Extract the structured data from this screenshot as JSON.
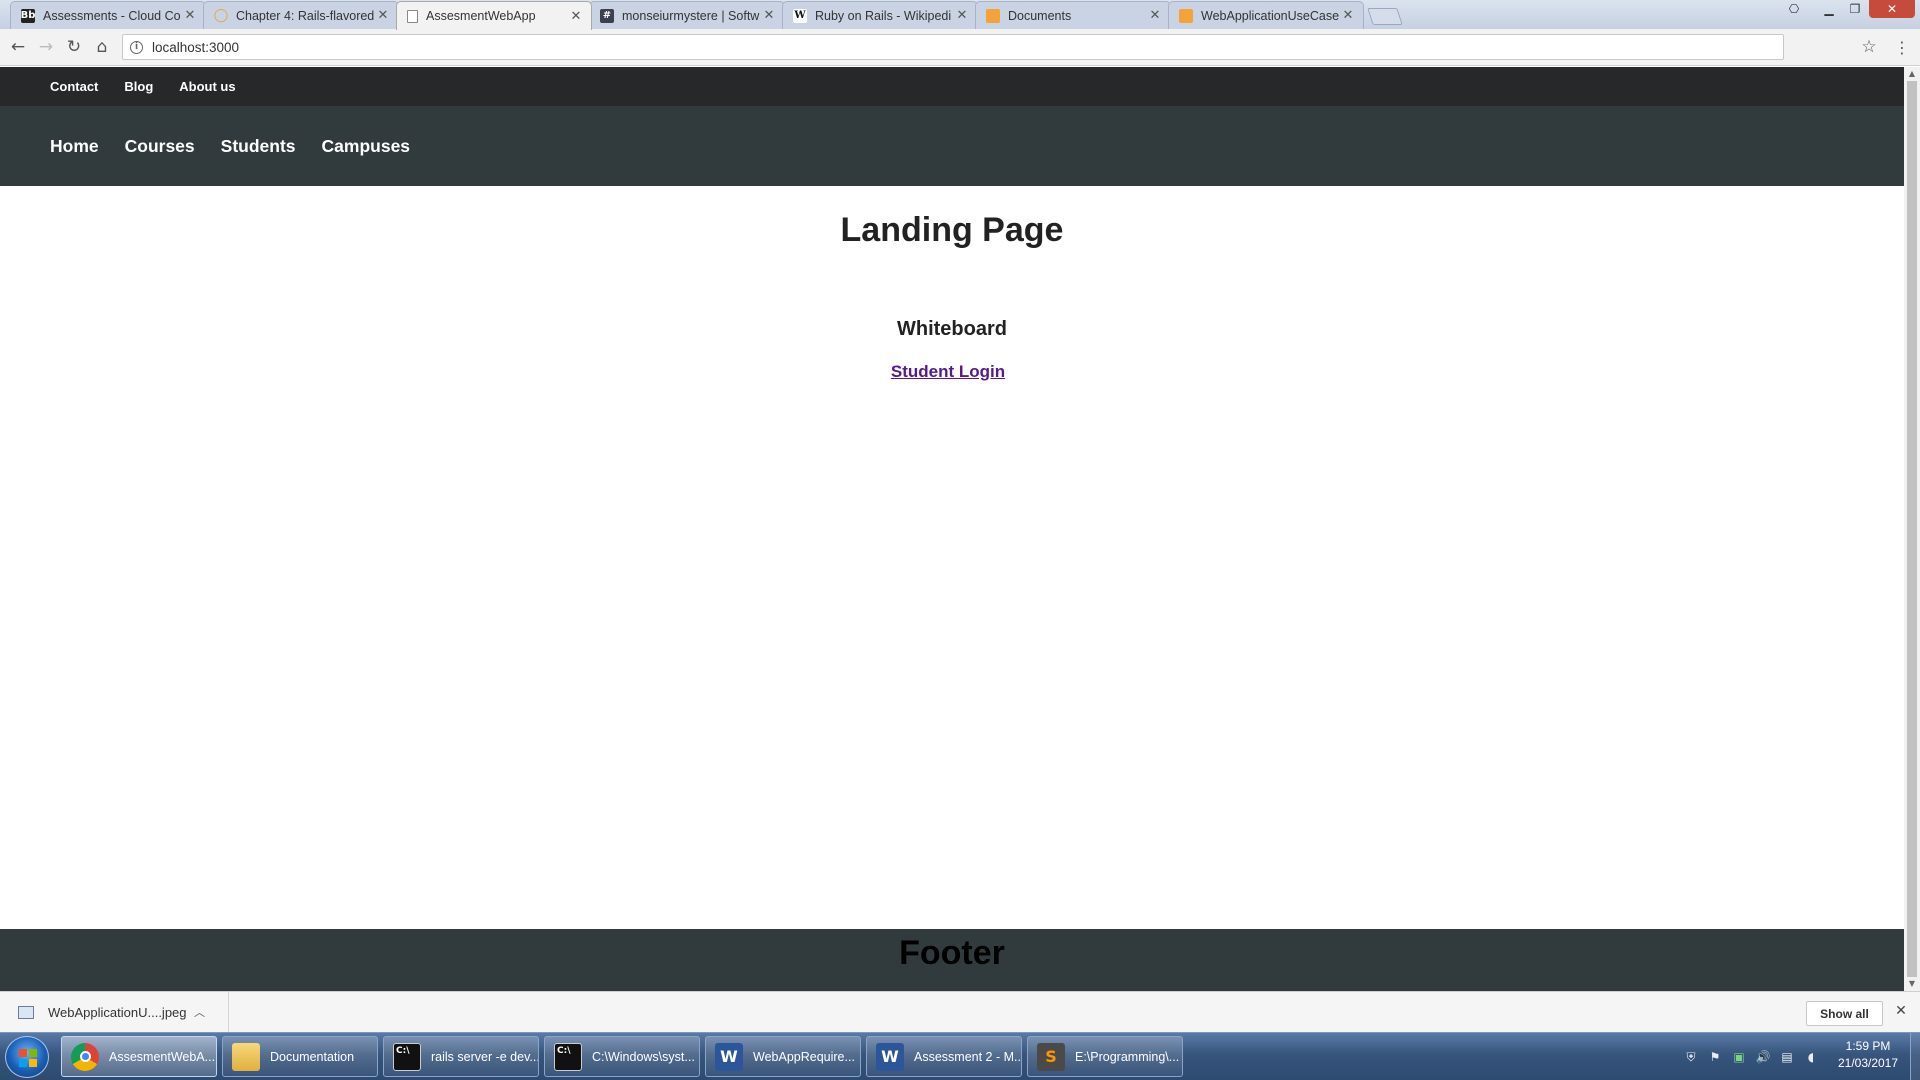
{
  "browser": {
    "tabs": [
      {
        "title": "Assessments - Cloud Co",
        "icon": "bb-icon",
        "icon_text": "Bb",
        "icon_color": "#222222",
        "active": false
      },
      {
        "title": "Chapter 4: Rails-flavored",
        "icon": "tutorial-icon",
        "icon_text": "◯",
        "icon_color": "#e8a23a",
        "active": false
      },
      {
        "title": "AssesmentWebApp",
        "icon": "page-icon",
        "icon_text": "",
        "icon_color": "#ffffff",
        "active": true
      },
      {
        "title": "monseiurmystere | Softw",
        "icon": "hash-icon",
        "icon_text": "#",
        "icon_color": "#3b3f4f",
        "active": false
      },
      {
        "title": "Ruby on Rails - Wikipedi",
        "icon": "wikipedia-icon",
        "icon_text": "W",
        "icon_color": "#ffffff",
        "active": false
      },
      {
        "title": "Documents",
        "icon": "drive-folder-icon",
        "icon_text": "",
        "icon_color": "#f2a33a",
        "active": false
      },
      {
        "title": "WebApplicationUseCase",
        "icon": "drawing-icon",
        "icon_text": "",
        "icon_color": "#f2a33a",
        "active": false
      }
    ],
    "url": "localhost:3000"
  },
  "site": {
    "top_links": [
      "Contact",
      "Blog",
      "About us"
    ],
    "main_links": [
      "Home",
      "Courses",
      "Students",
      "Campuses"
    ],
    "page_title": "Landing Page",
    "section_heading": "Whiteboard",
    "login_link": "Student Login",
    "footer": "Footer"
  },
  "downloads": {
    "file_name": "WebApplicationU....jpeg",
    "show_all": "Show all"
  },
  "taskbar": {
    "items": [
      {
        "label": "AssesmentWebA...",
        "icon": "chrome-icon",
        "active": true
      },
      {
        "label": "Documentation",
        "icon": "folder-icon",
        "active": false
      },
      {
        "label": "rails  server -e dev...",
        "icon": "cmd-icon",
        "active": false
      },
      {
        "label": "C:\\Windows\\syst...",
        "icon": "cmd-icon",
        "active": false
      },
      {
        "label": "WebAppRequire...",
        "icon": "word-icon",
        "active": false
      },
      {
        "label": "Assessment 2 - M...",
        "icon": "word-icon",
        "active": false
      },
      {
        "label": "E:\\Programming\\...",
        "icon": "sublime-icon",
        "active": false
      }
    ],
    "clock_time": "1:59 PM",
    "clock_date": "21/03/2017"
  },
  "colors": {
    "top_bar": "#262829",
    "main_nav": "#313a3d",
    "footer": "#313a3d",
    "visited_link": "#551a8b"
  }
}
